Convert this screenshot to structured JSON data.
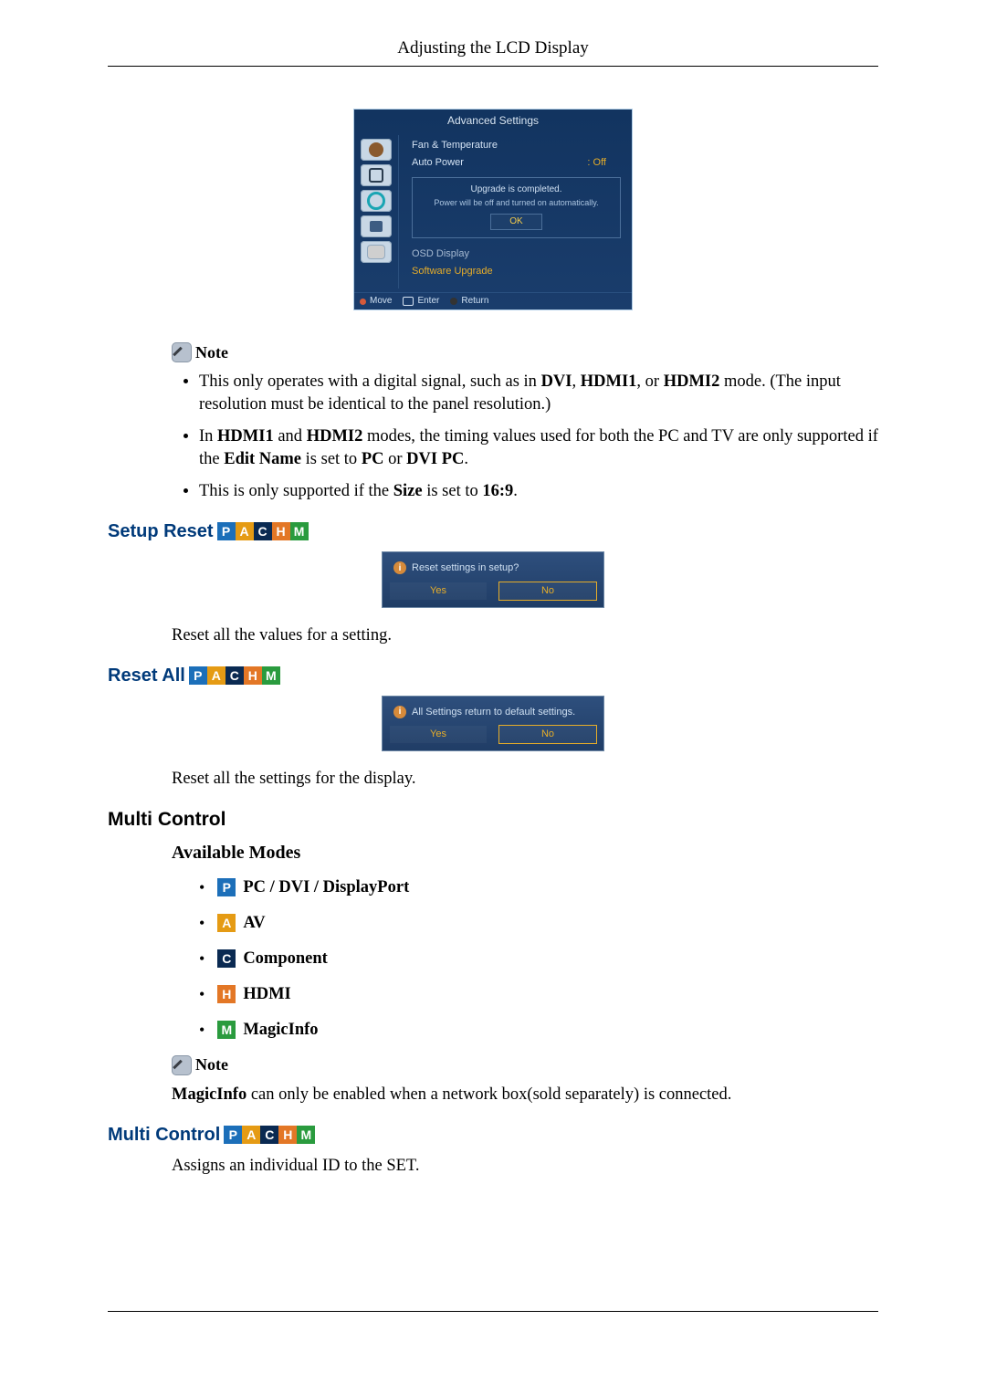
{
  "page": {
    "header_title": "Adjusting the LCD Display"
  },
  "osd": {
    "title": "Advanced Settings",
    "menu1": "Fan & Temperature",
    "menu2_label": "Auto Power",
    "menu2_value": ": Off",
    "dialog_line1": "Upgrade is completed.",
    "dialog_line2": "Power will be off and turned on automatically.",
    "dialog_ok": "OK",
    "menu3": "OSD Display",
    "menu4": "Software Upgrade",
    "footer_move": "Move",
    "footer_enter": "Enter",
    "footer_return": "Return"
  },
  "note_label": "Note",
  "notes1": {
    "item1_pre": "This only operates with a digital signal, such as in ",
    "dvi": "DVI",
    "sep1": ", ",
    "hdmi1": "HDMI1",
    "sep2": ", or ",
    "hdmi2": "HDMI2",
    "item1_post": " mode. (The input resolution must be identical to the panel resolution.)",
    "item2_pre": "In ",
    "item2_hdmi1": "HDMI1",
    "item2_and": " and ",
    "item2_hdmi2": "HDMI2",
    "item2_mid": " modes, the timing values used for both the PC and TV are only supported if the ",
    "item2_editname": "Edit Name",
    "item2_mid2": " is set to ",
    "item2_pc": "PC",
    "item2_or": " or ",
    "item2_dvipc": "DVI PC",
    "item2_end": ".",
    "item3_pre": "This is only supported if the ",
    "item3_size": "Size",
    "item3_mid": " is set to ",
    "item3_val": "16:9",
    "item3_end": "."
  },
  "sections": {
    "setup_reset": "Setup Reset",
    "reset_all": "Reset All",
    "multi_control": "Multi Control",
    "multi_control2": "Multi Control",
    "available_modes": "Available Modes"
  },
  "badges": {
    "P": "P",
    "A": "A",
    "C": "C",
    "H": "H",
    "M": "M"
  },
  "popup_setup": {
    "msg": "Reset settings in setup?",
    "yes": "Yes",
    "no": "No"
  },
  "popup_reset": {
    "msg": "All Settings return to default settings.",
    "yes": "Yes",
    "no": "No"
  },
  "paras": {
    "after_setup_reset": "Reset all the values for a setting.",
    "after_reset_all": "Reset all the settings for the display.",
    "multi_assigns": "Assigns an individual ID to the SET."
  },
  "modes": {
    "pc": "PC / DVI / DisplayPort",
    "av": "AV",
    "component": "Component",
    "hdmi": "HDMI",
    "magicinfo": "MagicInfo"
  },
  "notes2": {
    "pre_bold": "MagicInfo",
    "rest": " can only be enabled when a network box(sold separately) is connected."
  }
}
